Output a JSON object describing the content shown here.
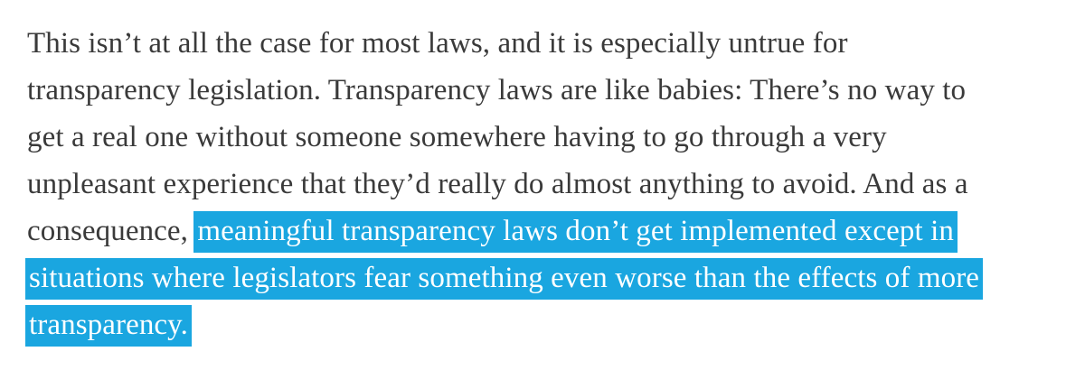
{
  "paragraph": {
    "line1": "This isn’t at all the case for most laws, and it is especially untrue for",
    "line2": "transparency legislation. Transparency laws are like babies: There’s no way to",
    "line3": "get a real one without someone somewhere having to go through a very",
    "line4": "unpleasant experience that they’d really do almost anything to avoid. And as a",
    "line5_plain": "consequence,",
    "line5_highlight": "meaningful transparency laws don’t get implemented except in",
    "line6_highlight": "situations where legislators fear something even worse than the effects of more",
    "line7_highlight": "transparency."
  },
  "colors": {
    "text": "#3a3a3a",
    "highlight_background": "#1aa6e0",
    "highlight_text": "#ffffff"
  }
}
